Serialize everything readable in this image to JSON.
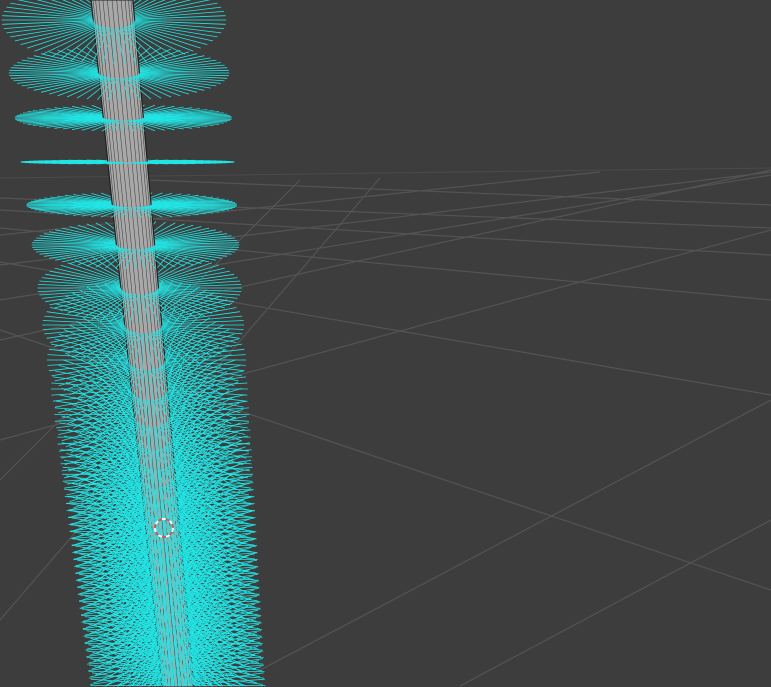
{
  "viewport": {
    "background_color": "#3d3d3d",
    "grid_color": "#545454",
    "horizon_color": "#4a4a4a",
    "mesh_color": "#a8a8a8",
    "mesh_wire_color": "#1e1e1e",
    "normals_color": "#22e5e5",
    "cursor_color": "#e05050",
    "cursor_icon": "3d-cursor-icon"
  }
}
